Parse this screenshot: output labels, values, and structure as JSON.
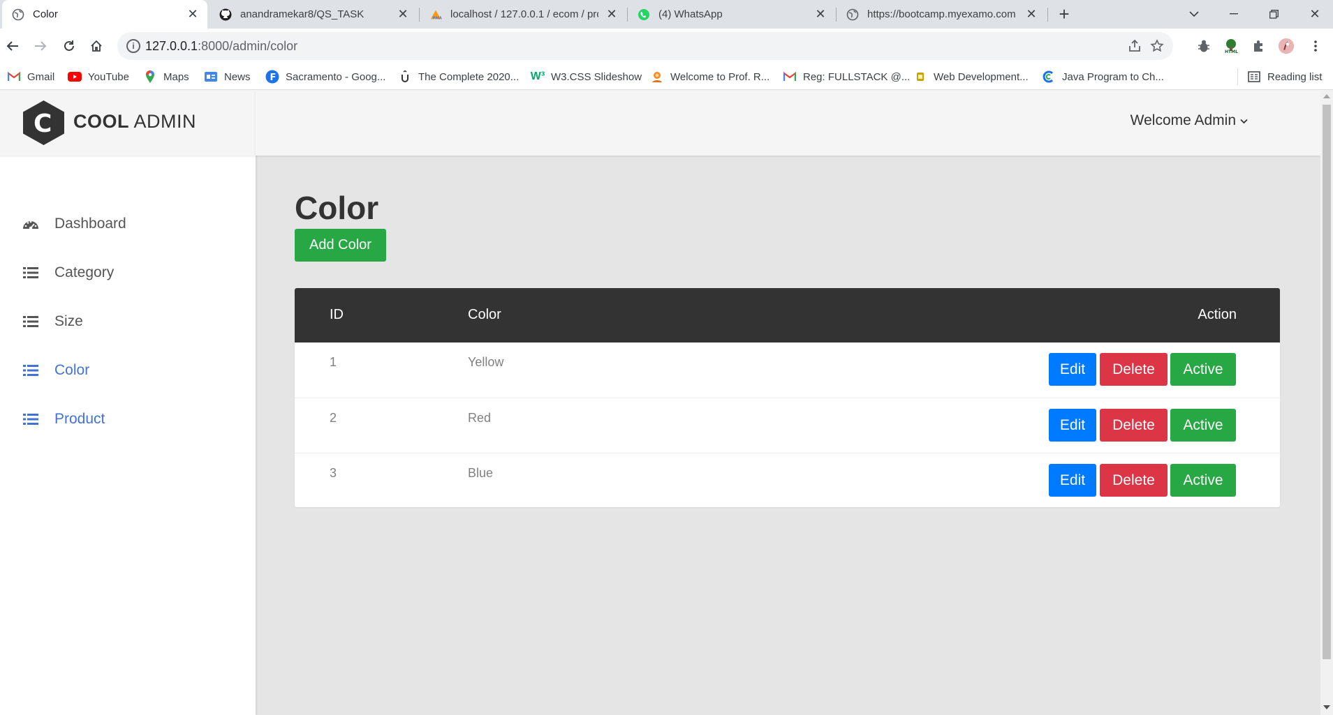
{
  "browser": {
    "tabs": [
      {
        "title": "Color",
        "icon": "globe-icon",
        "active": true
      },
      {
        "title": "anandramekar8/QS_TASK",
        "icon": "github-icon"
      },
      {
        "title": "localhost / 127.0.0.1 / ecom / pro",
        "icon": "phpmyadmin-icon"
      },
      {
        "title": "(4) WhatsApp",
        "icon": "whatsapp-icon"
      },
      {
        "title": "https://bootcamp.myexamo.com",
        "icon": "globe-icon"
      }
    ],
    "new_tab": "+",
    "url_host": "127.0.0.1",
    "url_rest": ":8000/admin/color",
    "bookmarks": [
      {
        "label": "Gmail",
        "icon": "gmail-icon",
        "color": "#ea4335"
      },
      {
        "label": "YouTube",
        "icon": "youtube-icon",
        "color": "#ff0000"
      },
      {
        "label": "Maps",
        "icon": "maps-icon",
        "color": "#34a853"
      },
      {
        "label": "News",
        "icon": "news-icon",
        "color": "#4285f4"
      },
      {
        "label": "Sacramento - Goog...",
        "icon": "f-icon",
        "color": "#1a73e8"
      },
      {
        "label": "The Complete 2020...",
        "icon": "udemy-icon",
        "color": "#333333"
      },
      {
        "label": "W3.CSS Slideshow",
        "icon": "w3-icon",
        "color": "#04aa6d"
      },
      {
        "label": "Welcome to Prof. R...",
        "icon": "prof-icon",
        "color": "#f28b20"
      },
      {
        "label": "Reg: FULLSTACK @...",
        "icon": "gmail-icon",
        "color": "#ea4335"
      },
      {
        "label": "Web Development...",
        "icon": "webdev-icon",
        "color": "#c9a200"
      },
      {
        "label": "Java Program to Ch...",
        "icon": "java-icon",
        "color": "#1a73e8"
      }
    ],
    "reading_list": "Reading list"
  },
  "app": {
    "logo_bold": "COOL",
    "logo_light": "ADMIN",
    "logo_letter": "C",
    "welcome": "Welcome Admin",
    "nav": [
      {
        "label": "Dashboard",
        "icon": "dashboard-icon",
        "active": false
      },
      {
        "label": "Category",
        "icon": "list-icon",
        "active": false
      },
      {
        "label": "Size",
        "icon": "list-icon",
        "active": false
      },
      {
        "label": "Color",
        "icon": "list-icon",
        "active": true
      },
      {
        "label": "Product",
        "icon": "list-icon",
        "active": true
      }
    ],
    "page_title": "Color",
    "add_button": "Add Color",
    "table": {
      "headers": [
        "ID",
        "Color",
        "Action"
      ],
      "rows": [
        {
          "id": "1",
          "color": "Yellow"
        },
        {
          "id": "2",
          "color": "Red"
        },
        {
          "id": "3",
          "color": "Blue"
        }
      ],
      "actions": {
        "edit": "Edit",
        "delete": "Delete",
        "active": "Active"
      }
    }
  },
  "colors": {
    "green": "#28a745",
    "blue": "#007bff",
    "red": "#dc3545",
    "nav_active": "#4272d7",
    "table_header": "#333333"
  }
}
